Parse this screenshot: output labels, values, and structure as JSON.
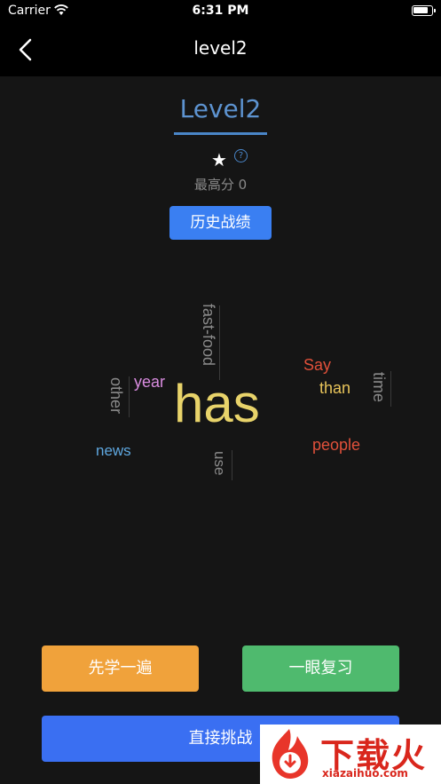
{
  "status": {
    "carrier": "Carrier",
    "time": "6:31 PM",
    "battery_level": 0.85
  },
  "nav": {
    "title": "level2"
  },
  "level": {
    "tab_label": "Level2",
    "star_icon": "★",
    "help_icon": "?",
    "best_score": "最高分 0"
  },
  "history_button": "历史战绩",
  "word_cloud": {
    "words": [
      {
        "text": "has",
        "color": "#e8d36a",
        "orientation": "horizontal"
      },
      {
        "text": "fast-food",
        "color": "#8a8a8a",
        "orientation": "vertical"
      },
      {
        "text": "Say",
        "color": "#e0503a",
        "orientation": "horizontal"
      },
      {
        "text": "than",
        "color": "#e8c45a",
        "orientation": "horizontal"
      },
      {
        "text": "time",
        "color": "#8a8a8a",
        "orientation": "vertical"
      },
      {
        "text": "year",
        "color": "#d98ce0",
        "orientation": "horizontal"
      },
      {
        "text": "other",
        "color": "#8a8a8a",
        "orientation": "vertical"
      },
      {
        "text": "news",
        "color": "#5fa8e0",
        "orientation": "horizontal"
      },
      {
        "text": "use",
        "color": "#8a8a8a",
        "orientation": "vertical"
      },
      {
        "text": "people",
        "color": "#e0503a",
        "orientation": "horizontal"
      }
    ]
  },
  "buttons": {
    "learn": "先学一遍",
    "review": "一眼复习",
    "challenge": "直接挑战"
  },
  "watermark": {
    "title": "下载火",
    "url": "xiazaihuo.com"
  }
}
